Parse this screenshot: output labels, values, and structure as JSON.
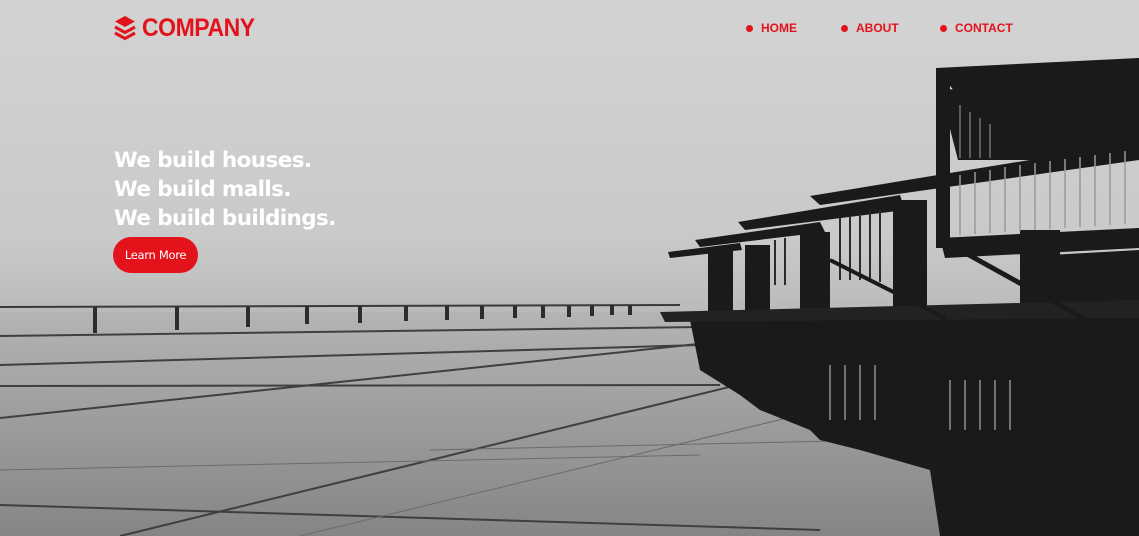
{
  "brand": {
    "name": "COMPANY",
    "icon": "layers-icon",
    "accent_color": "#e3121b"
  },
  "nav": {
    "items": [
      {
        "label": "HOME",
        "icon": "dot-icon"
      },
      {
        "label": "ABOUT",
        "icon": "dot-icon"
      },
      {
        "label": "CONTACT",
        "icon": "dot-icon"
      }
    ]
  },
  "hero": {
    "headline": [
      "We build houses.",
      "We build malls.",
      "We build buildings."
    ],
    "cta_label": "Learn More",
    "background": "grayscale photo of a modern building reflected on a glossy rooftop"
  }
}
